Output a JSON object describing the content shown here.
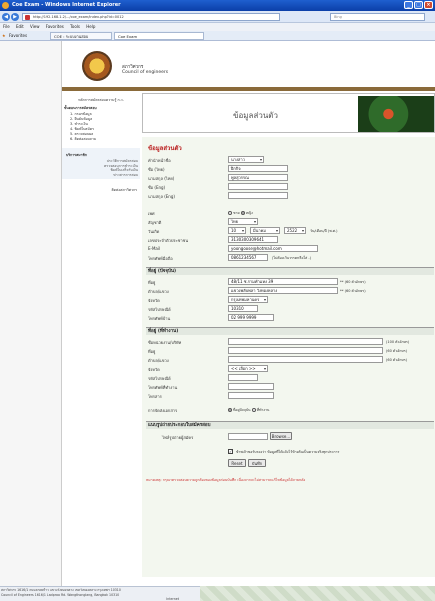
{
  "window": {
    "title": "Coe Exam - Windows Internet Explorer",
    "min": "_",
    "max": "□",
    "close": "×"
  },
  "address": {
    "url": "http://192.168.1.2/.../coe_exam/index.php?id=0012",
    "search": "Bing"
  },
  "menu": [
    "File",
    "Edit",
    "View",
    "Favorites",
    "Tools",
    "Help"
  ],
  "favbar": {
    "favorites": "Favorites",
    "tab1": "COE : ระบบงานสอบ",
    "tab2": "Coe Exam"
  },
  "org": {
    "name_th": "สภาวิศวกร",
    "name_en": "Council of engineers"
  },
  "leftnav": {
    "top": "หลักการสมัครสอบความรู้ ก.ว.",
    "head1": "ขั้นตอนการสมัครสอบ",
    "steps": [
      "1. กรอกข้อมูล",
      "2. ยืนยันข้อมูล",
      "3. ชำระเงิน",
      "4. พิมพ์ใบสมัคร",
      "5. ตรวจสอบผล",
      "6. ติดต่อสอบถาม"
    ],
    "head2": "บริการสมาชิก",
    "sub": [
      "ประวัติการสมัครสอบ",
      "ตรวจสอบการชำระเงิน",
      "พิมพ์ใบเสร็จรับเงิน",
      "ข่าวสารการสอบ"
    ],
    "contact": "ติดต่อสภาวิศวกร"
  },
  "banner": {
    "title": "ข้อมูลส่วนตัว"
  },
  "form": {
    "section": "ข้อมูลส่วนตัว",
    "labels": {
      "prefix": "คำนำหน้าชื่อ",
      "fname_th": "ชื่อ (ไทย)",
      "lname_th": "นามสกุล (ไทย)",
      "fname_en": "ชื่อ (Eng)",
      "lname_en": "นามสกุล (Eng)",
      "sex": "เพศ",
      "nationality": "สัญชาติ",
      "birthdate": "วันเกิด",
      "idcard": "เลขประจำตัวประชาชน",
      "email": "E-Mail",
      "mobile": "โทรศัพท์มือถือ"
    },
    "values": {
      "prefix": "นางสาว",
      "fname_th": "ฝึกกิจ",
      "lname_th": "พูลสุวรรณ",
      "nationality": "ไทย",
      "day": "10",
      "month": "มีนาคม",
      "year": "2522",
      "idcard": "3130300309641",
      "email": "yoongoose@hotmail.com",
      "mobile": "0861234567"
    },
    "sex_options": [
      "ชาย",
      "หญิง"
    ],
    "date_format": "วัน/เดือน/ปี (พ.ศ.)",
    "mobile_note": "(ไม่ต้องเว้นวรรคหรือใส่ -)",
    "addr1_title": "ที่อยู่ (ปัจจุบัน)",
    "addr1_labels": [
      "ที่อยู่",
      "ตำบล/แขวง",
      "จังหวัด",
      "รหัสไปรษณีย์",
      "โทรศัพท์บ้าน"
    ],
    "addr1_values": [
      "48/11 ซ.รามคำแหง 39",
      "แขวงพลับพลา วังทองหลาง",
      "กรุงเทพมหานคร",
      "10310",
      "02 999 9999"
    ],
    "limit60": "** (60 ตัวอักษร)",
    "addr2_title": "ที่อยู่ (ที่ทำงาน)",
    "addr2_labels": [
      "ชื่อหน่วยงาน/บริษัท",
      "ที่อยู่",
      "ตำบล/แขวง",
      "จังหวัด",
      "รหัสไปรษณีย์",
      "โทรศัพท์ที่ทำงาน",
      "โทรสาร"
    ],
    "addr2_limits": [
      "(100 ตัวอักษร)",
      "(60 ตัวอักษร)",
      "(60 ตัวอักษร)"
    ],
    "province_placeholder": "<< เลือก >>",
    "mail_label": "การจัดส่งเอกสาร",
    "mail_options": [
      "ที่อยู่ปัจจุบัน",
      "ที่ทำงาน"
    ],
    "photo_title": "แนบรูปถ่ายประกอบใบสมัครสอบ",
    "photo_label": "ไฟล์รูปถ่ายผู้สมัคร",
    "browse": "Browse...",
    "agree": "ข้าพเจ้าขอรับรองว่า ข้อมูลที่ได้แจ้งไว้ข้างต้นเป็นความจริงทุกประการ",
    "reset": "Reset",
    "submit": "บันทึก",
    "warning": "หมายเหตุ: กรุณาตรวจสอบความถูกต้องของข้อมูลก่อนบันทึก เนื่องจากจะไม่สามารถแก้ไขข้อมูลได้ภายหลัง"
  },
  "status": {
    "line1": "สภาวิศวกร 1616/1 ถนนลาดพร้าว แขวงวังทองหลาง เขตวังทองหลาง กรุงเทพฯ 10310",
    "line2": "Council of Engineers 1616/1 Ladprao Rd. Wangthonglang, Bangkok 10310",
    "zone": "Internet"
  }
}
